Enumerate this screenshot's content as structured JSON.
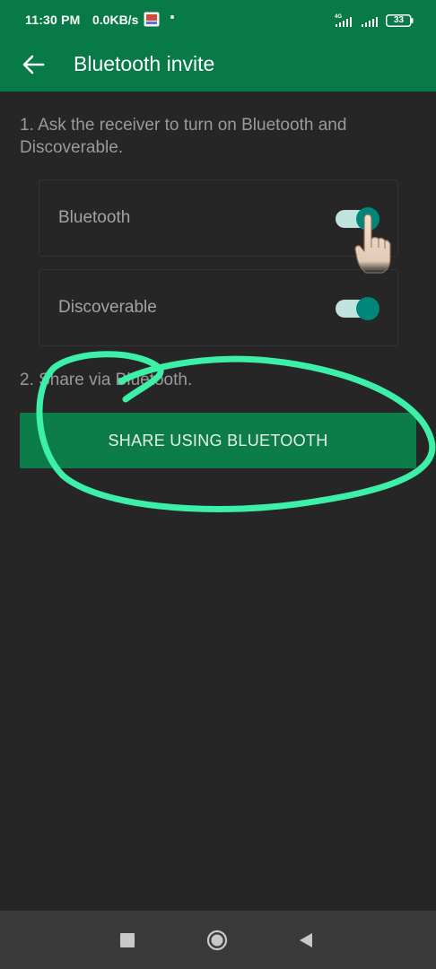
{
  "status_bar": {
    "time": "11:30 PM",
    "network_speed": "0.0KB/s",
    "notification_icon": "app-notification-icon",
    "signal_1_label": "4G",
    "battery_level": "33"
  },
  "app_bar": {
    "title": "Bluetooth invite",
    "back_icon": "arrow-left-icon"
  },
  "steps": {
    "step1": "1. Ask the receiver to turn on Bluetooth and Discoverable.",
    "step2": "2. Share via Bluetooth."
  },
  "settings": [
    {
      "label": "Bluetooth",
      "enabled": true
    },
    {
      "label": "Discoverable",
      "enabled": true
    }
  ],
  "share_button": {
    "label": "SHARE USING BLUETOOTH"
  },
  "colors": {
    "app_bar": "#087a48",
    "background": "#262626",
    "toggle_thumb": "#00877a",
    "toggle_track": "#bfe3dd",
    "button": "#0c7d48",
    "annotation": "#3cf0a8"
  },
  "nav_bar": {
    "recents_icon": "square-icon",
    "home_icon": "circle-home-icon",
    "back_icon": "triangle-back-icon"
  }
}
